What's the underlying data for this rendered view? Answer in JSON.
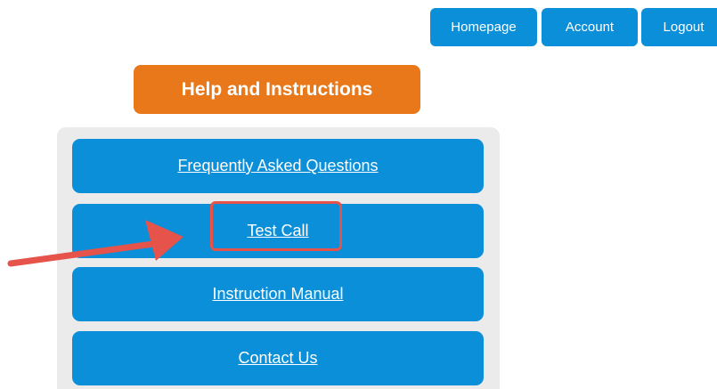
{
  "nav": {
    "homepage": "Homepage",
    "account": "Account",
    "logout": "Logout"
  },
  "help": {
    "title": "Help and Instructions"
  },
  "menu": {
    "faq": "Frequently Asked Questions",
    "test_call": "Test Call",
    "manual": "Instruction Manual",
    "contact": "Contact Us"
  },
  "colors": {
    "primary_blue": "#0b8fd9",
    "header_orange": "#e8781a",
    "panel_gray": "#ebebeb",
    "annotation_red": "#e5534b"
  },
  "annotation": {
    "arrow_icon": "red-arrow-icon",
    "highlight": "red-highlight-box"
  }
}
